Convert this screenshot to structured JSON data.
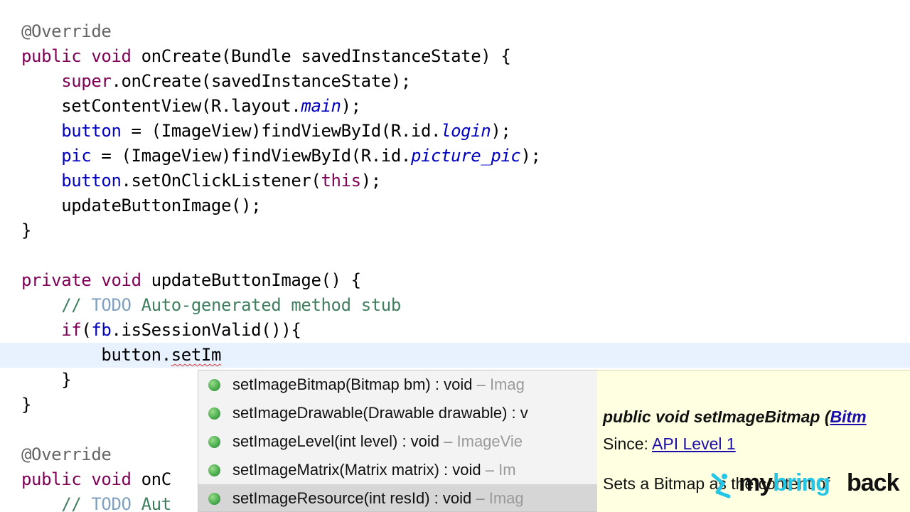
{
  "editor": {
    "current_line_index": 13,
    "lines": [
      [
        {
          "t": "@Override",
          "c": "ann"
        }
      ],
      [
        {
          "t": "public",
          "c": "kw"
        },
        {
          "t": " "
        },
        {
          "t": "void",
          "c": "kw"
        },
        {
          "t": " onCreate(Bundle savedInstanceState) {"
        }
      ],
      [
        {
          "t": "    "
        },
        {
          "t": "super",
          "c": "kw"
        },
        {
          "t": ".onCreate(savedInstanceState);"
        }
      ],
      [
        {
          "t": "    setContentView(R.layout."
        },
        {
          "t": "main",
          "c": "static"
        },
        {
          "t": ");"
        }
      ],
      [
        {
          "t": "    "
        },
        {
          "t": "button",
          "c": "field"
        },
        {
          "t": " = (ImageView)findViewById(R.id."
        },
        {
          "t": "login",
          "c": "static"
        },
        {
          "t": ");"
        }
      ],
      [
        {
          "t": "    "
        },
        {
          "t": "pic",
          "c": "field"
        },
        {
          "t": " = (ImageView)findViewById(R.id."
        },
        {
          "t": "picture_pic",
          "c": "static"
        },
        {
          "t": ");"
        }
      ],
      [
        {
          "t": "    "
        },
        {
          "t": "button",
          "c": "field"
        },
        {
          "t": ".setOnClickListener("
        },
        {
          "t": "this",
          "c": "kw"
        },
        {
          "t": ");"
        }
      ],
      [
        {
          "t": "    updateButtonImage();"
        }
      ],
      [
        {
          "t": "}"
        }
      ],
      [],
      [
        {
          "t": "private",
          "c": "kw"
        },
        {
          "t": " "
        },
        {
          "t": "void",
          "c": "kw"
        },
        {
          "t": " updateButtonImage() {"
        }
      ],
      [
        {
          "t": "    "
        },
        {
          "t": "// ",
          "c": "comment"
        },
        {
          "t": "TODO",
          "c": "todo"
        },
        {
          "t": " Auto-generated method stub",
          "c": "comment"
        }
      ],
      [
        {
          "t": "    "
        },
        {
          "t": "if",
          "c": "kw"
        },
        {
          "t": "("
        },
        {
          "t": "fb",
          "c": "field"
        },
        {
          "t": ".isSessionValid()){"
        }
      ],
      [
        {
          "t": "        button."
        },
        {
          "t": "setIm",
          "c": "err"
        }
      ],
      [
        {
          "t": "    }"
        }
      ],
      [
        {
          "t": "}"
        }
      ],
      [],
      [
        {
          "t": "@Override",
          "c": "ann"
        }
      ],
      [
        {
          "t": "public",
          "c": "kw"
        },
        {
          "t": " "
        },
        {
          "t": "void",
          "c": "kw"
        },
        {
          "t": " onC"
        }
      ],
      [
        {
          "t": "    "
        },
        {
          "t": "// ",
          "c": "comment"
        },
        {
          "t": "TODO",
          "c": "todo"
        },
        {
          "t": " Aut",
          "c": "comment"
        }
      ]
    ]
  },
  "proposals": {
    "selected_index": 4,
    "items": [
      {
        "icon": "public-method-icon",
        "signature": "setImageBitmap(Bitmap bm) : void",
        "separator": " – ",
        "owner": "Imag"
      },
      {
        "icon": "public-method-icon",
        "signature": "setImageDrawable(Drawable drawable) : v",
        "separator": "",
        "owner": ""
      },
      {
        "icon": "public-method-icon",
        "signature": "setImageLevel(int level) : void",
        "separator": " – ",
        "owner": "ImageVie"
      },
      {
        "icon": "public-method-icon",
        "signature": "setImageMatrix(Matrix matrix) : void",
        "separator": " – ",
        "owner": "Im"
      },
      {
        "icon": "public-method-icon",
        "signature": "setImageResource(int resId) : void",
        "separator": " – ",
        "owner": "Imag"
      }
    ]
  },
  "javadoc": {
    "signature_prefix": "public void setImageBitmap (",
    "signature_link": "Bitm",
    "since_label": "Since: ",
    "since_link": "API Level 1",
    "description": "Sets a Bitmap as the content of"
  },
  "watermark": {
    "part1": "my",
    "part2": "bring",
    "part3": "back"
  }
}
